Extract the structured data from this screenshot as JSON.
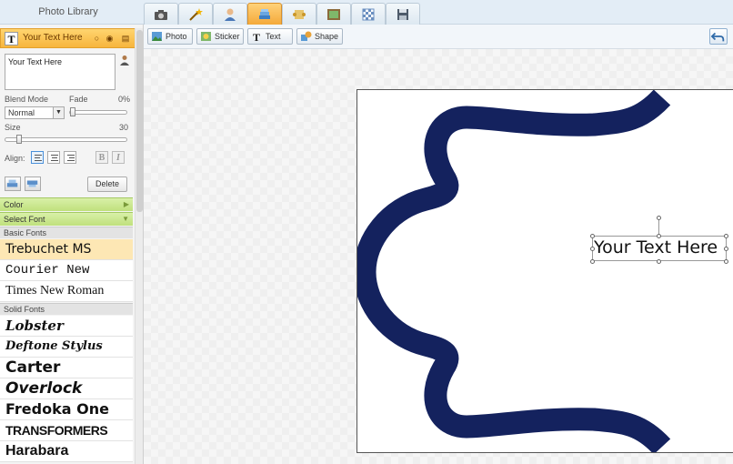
{
  "top_bar": {
    "library_title": "Photo Library",
    "tabs": [
      {
        "name": "camera-icon"
      },
      {
        "name": "magic-wand-icon"
      },
      {
        "name": "person-icon"
      },
      {
        "name": "layers-icon",
        "active": true
      },
      {
        "name": "scroll-icon"
      },
      {
        "name": "picture-frame-icon"
      },
      {
        "name": "transparency-icon"
      },
      {
        "name": "save-icon"
      }
    ]
  },
  "layer": {
    "name": "Your Text Here",
    "type_glyph": "T"
  },
  "text_props": {
    "text_value": "Your Text Here",
    "blend_mode_label": "Blend Mode",
    "blend_mode_value": "Normal",
    "fade_label": "Fade",
    "fade_value": "0%",
    "fade_level": 0,
    "size_label": "Size",
    "size_value": "30",
    "align_label": "Align:",
    "bold_glyph": "B",
    "italic_glyph": "I",
    "delete_label": "Delete"
  },
  "sections": {
    "color": "Color",
    "select_font": "Select Font",
    "basic_fonts": "Basic Fonts",
    "solid_fonts": "Solid Fonts"
  },
  "basic_fonts": [
    "Trebuchet MS",
    "Courier New",
    "Times New Roman"
  ],
  "solid_fonts": [
    "Lobster",
    "Deftone Stylus",
    "Carter",
    "Overlock",
    "Fredoka One",
    "TRANSFORMERS",
    "Harabara"
  ],
  "toolbar": {
    "photo": "Photo",
    "sticker": "Sticker",
    "text": "Text",
    "shape": "Shape"
  },
  "canvas": {
    "text": "Your Text Here",
    "frame_color": "#14225e"
  }
}
